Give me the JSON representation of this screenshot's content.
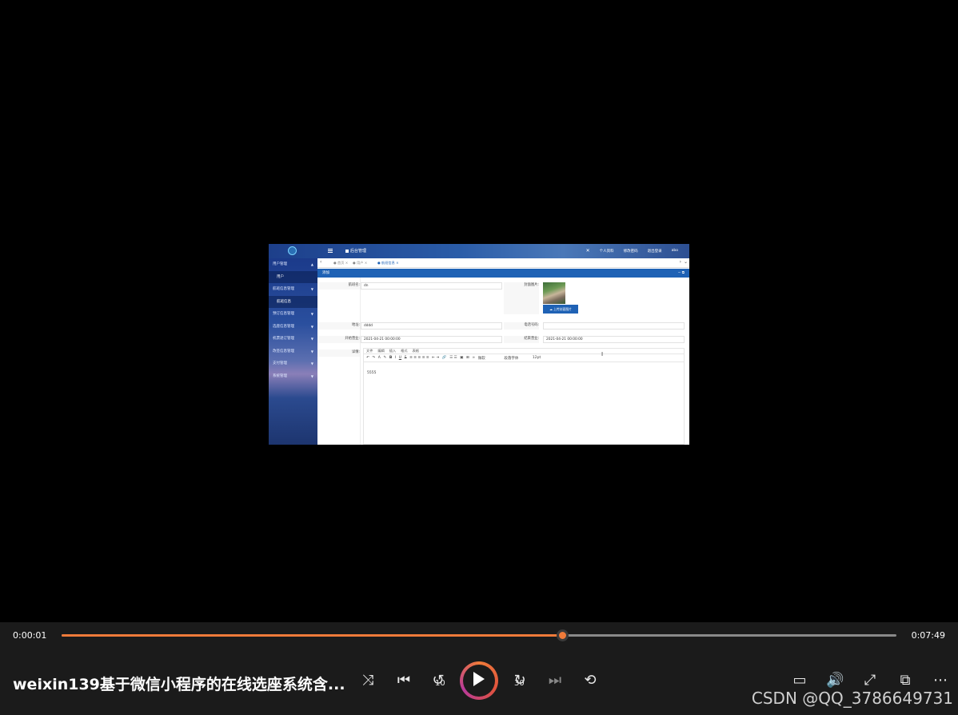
{
  "embedded": {
    "topbar": {
      "system_title": "后台管理",
      "right_items": [
        "个人资料",
        "修改密码",
        "退出登录",
        "abo"
      ]
    },
    "sidebar": {
      "items": [
        {
          "label": "用户管理",
          "type": "group"
        },
        {
          "label": "用户",
          "type": "sub"
        },
        {
          "label": "航班信息管理",
          "type": "group"
        },
        {
          "label": "航班信息",
          "type": "sub"
        },
        {
          "label": "预订信息管理",
          "type": "group"
        },
        {
          "label": "选座信息管理",
          "type": "group"
        },
        {
          "label": "机票退订管理",
          "type": "group"
        },
        {
          "label": "改签信息管理",
          "type": "group"
        },
        {
          "label": "支付管理",
          "type": "group"
        },
        {
          "label": "系统管理",
          "type": "group"
        }
      ]
    },
    "tabs": [
      "首页",
      "用户",
      "航班信息"
    ],
    "panel_title": "添加",
    "form": {
      "flight_name_label": "航班名:",
      "flight_name_value": "dn",
      "cover_label": "封面图片:",
      "upload_label": "上传封面图片",
      "address_label": "地址:",
      "address_value": "dddd",
      "phone_label": "电话号码:",
      "phone_value": "",
      "start_label": "开始营业:",
      "start_value": "2021-04-21 00:00:00",
      "end_label": "结束营业:",
      "end_value": "2021-04-21 00:00:00",
      "detail_label": "详情:",
      "editor_menu": [
        "文件",
        "编辑",
        "插入",
        "格式",
        "表格"
      ],
      "editor_font": "微软",
      "editor_block": "段落字体",
      "editor_size": "12pt",
      "editor_content": "5555"
    }
  },
  "player": {
    "current_time": "0:00:01",
    "total_time": "0:07:49",
    "progress": 0.6,
    "title": "weixin139基于微信小程序的在线选座系统含...",
    "skip_back": "10",
    "skip_forward": "30",
    "accent_color": "#f07b3a"
  },
  "watermark": "CSDN @QQ_3786649731"
}
